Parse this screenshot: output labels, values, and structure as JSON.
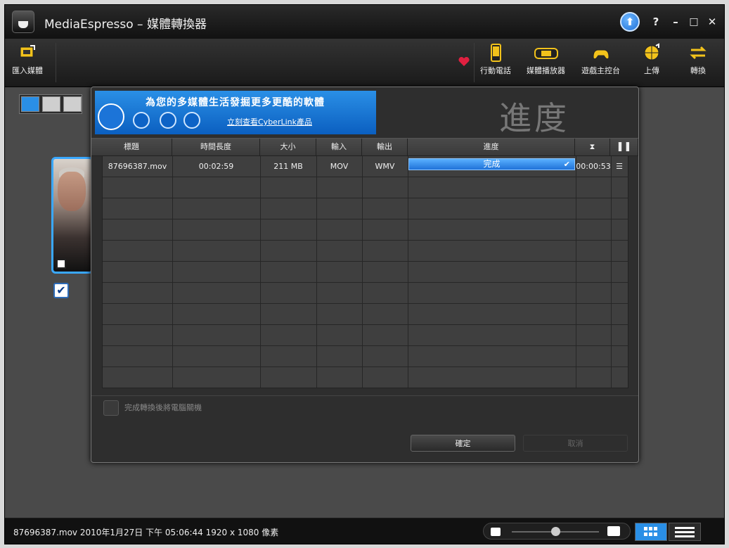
{
  "window": {
    "title": "MediaEspresso – 媒體轉換器",
    "controls": {
      "help": "?",
      "minimize": "–",
      "maximize": "□",
      "close": "✕"
    }
  },
  "toolbar": {
    "import_media": "匯入媒體",
    "mobile_phone": "行動電話",
    "media_player": "媒體播放器",
    "game_console": "遊戲主控台",
    "upload": "上傳",
    "convert": "轉換"
  },
  "dialog": {
    "banner": {
      "headline": "為您的多媒體生活發掘更多更酷的軟體",
      "link": "立刻查看CyberLink產品"
    },
    "title": "進度",
    "columns": [
      "標題",
      "時間長度",
      "大小",
      "輸入",
      "輸出",
      "進度"
    ],
    "rows": [
      {
        "title": "87696387.mov",
        "duration": "00:02:59",
        "size": "211 MB",
        "input": "MOV",
        "output": "WMV",
        "progress_label": "完成",
        "progress_fraction": 1.0,
        "elapsed": "00:00:53"
      }
    ],
    "shutdown_label": "完成轉換後將電腦關機",
    "ok_button": "確定",
    "cancel_button": "取消"
  },
  "statusbar": {
    "info": "87696387.mov 2010年1月27日 下午 05:06:44 1920 x 1080 像素"
  },
  "colors": {
    "accent": "#2a8fe6",
    "progress": "#1f72d8",
    "thumb_border": "#3aa8ff",
    "heart": "#e02040"
  }
}
